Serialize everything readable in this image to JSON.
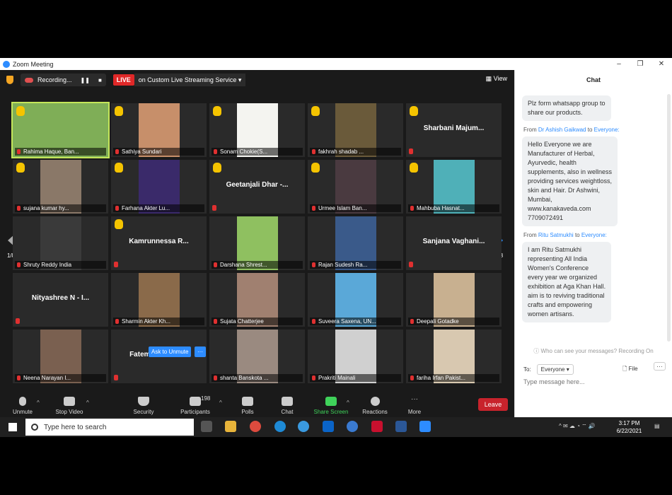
{
  "window": {
    "title": "Zoom Meeting"
  },
  "topbar": {
    "recording": "Recording...",
    "live": "LIVE",
    "stream": "on Custom Live Streaming Service",
    "view": "View"
  },
  "tiles": [
    {
      "name": "Rahima Haque, Ban...",
      "hand": true,
      "video": true,
      "active": true,
      "bg": "#7fae57"
    },
    {
      "name": "Sathiya Sundari",
      "hand": true,
      "video": true,
      "bg": "#c78f6a"
    },
    {
      "name": "Sonam Chokie(S...",
      "hand": true,
      "video": true,
      "bg": "#f4f4f0"
    },
    {
      "name": "fakhrah shadab ...",
      "hand": true,
      "video": true,
      "bg": "#6a5a3a"
    },
    {
      "name": "Sharbani Majum...",
      "hand": true,
      "video": false
    },
    {
      "name": "sujana kumar hy...",
      "hand": true,
      "video": true,
      "bg": "#8a7868"
    },
    {
      "name": "Farhana Akter Lu...",
      "hand": true,
      "video": true,
      "bg": "#3a2a6a"
    },
    {
      "name": "Geetanjali Dhar -...",
      "hand": true,
      "video": false
    },
    {
      "name": "Urmee Islam Ban...",
      "hand": true,
      "video": true,
      "bg": "#4a3a40"
    },
    {
      "name": "Mahbuba Hasnat...",
      "hand": true,
      "video": true,
      "bg": "#4fb0b8"
    },
    {
      "name": "Shruty Reddy India",
      "hand": false,
      "video": true,
      "bg": "#3a3a3a"
    },
    {
      "name": "Kamrunnessa R...",
      "hand": true,
      "video": false
    },
    {
      "name": "Darshana Shrest...",
      "hand": false,
      "video": true,
      "bg": "#8fc060"
    },
    {
      "name": "Rajan Sudesh Ra...",
      "hand": false,
      "video": true,
      "bg": "#3a5a8a"
    },
    {
      "name": "Sanjana Vaghani...",
      "hand": false,
      "video": false
    },
    {
      "name": "Nityashree N - I...",
      "hand": false,
      "video": false
    },
    {
      "name": "Sharmin Akter Kh...",
      "hand": false,
      "video": true,
      "bg": "#8a6a4a"
    },
    {
      "name": "Sujata Chatterjee",
      "hand": false,
      "video": true,
      "bg": "#a08070"
    },
    {
      "name": "Suveera Saxena, UN...",
      "hand": false,
      "video": true,
      "bg": "#5aa8d8"
    },
    {
      "name": "Deepali Gotadke",
      "hand": false,
      "video": true,
      "bg": "#c8b090"
    },
    {
      "name": "Neena Narayan I...",
      "hand": false,
      "video": true,
      "bg": "#7a6050"
    },
    {
      "name": "Fatemeh Derisavi",
      "hand": false,
      "video": false
    },
    {
      "name": "shanta Banskota ...",
      "hand": false,
      "video": true,
      "bg": "#9a8a80"
    },
    {
      "name": "Prakriti Mainali",
      "hand": false,
      "video": true,
      "bg": "#d0d0d0"
    },
    {
      "name": "fariha Irfan Pakist...",
      "hand": false,
      "video": true,
      "bg": "#d8c8b0"
    }
  ],
  "pager": {
    "left": "1/8",
    "right": "1/8"
  },
  "unmute": {
    "label": "Ask to Unmute",
    "more": "···"
  },
  "toolbar": {
    "unmute": "Unmute",
    "stop_video": "Stop Video",
    "security": "Security",
    "participants": "Participants",
    "participant_count": "198",
    "polls": "Polls",
    "chat": "Chat",
    "share": "Share Screen",
    "reactions": "Reactions",
    "more": "More",
    "leave": "Leave"
  },
  "chat": {
    "header": "Chat",
    "messages": [
      {
        "from": "",
        "to": "",
        "text": "Plz form whatsapp group to\nshare our products."
      },
      {
        "from": "Dr  Ashish Gaikwad",
        "to": "Everyone:",
        "text": "Hello Everyone  we are\nManufacturer of Herbal,\nAyurvedic, health\nsupplements,  also in wellness\nproviding services weightloss,\nskin and Hair.    Dr Ashwini,\nMumbai,\nwww.kanakaveda.com\n7709072491"
      },
      {
        "from": "Ritu Satmukhi",
        "to": "Everyone:",
        "text": "I am Ritu Satmukhi\nrepresenting All India\nWomen's Conference\nevery year we organized\nexhibition at Aga Khan Hall.\naim is to reviving traditional\ncrafts and empowering\nwomen artisans."
      }
    ],
    "from_label": "From",
    "to_label": "to",
    "notice": "Who can see your messages? Recording On",
    "to": "To:",
    "recipient": "Everyone",
    "file": "File",
    "dots": "···",
    "placeholder": "Type message here..."
  },
  "taskbar": {
    "search_placeholder": "Type here to search",
    "time": "3:17 PM",
    "date": "6/22/2021"
  }
}
